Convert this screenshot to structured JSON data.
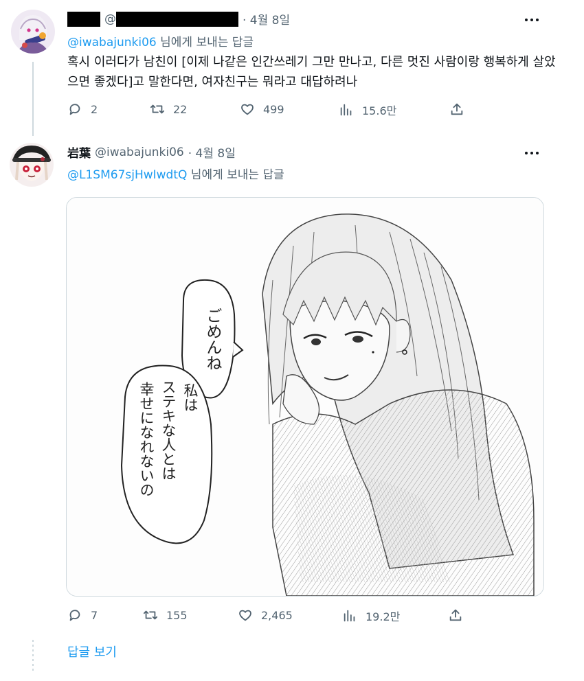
{
  "tweet1": {
    "handle_prefix": "@",
    "time": "· 4월 8일",
    "reply_handle": "@iwabajunki06",
    "reply_suffix": " 님에게 보내는 답글",
    "text": "혹시 이러다가 남친이 [이제 나같은 인간쓰레기 그만 만나고, 다른 멋진 사람이랑 행복하게 살았으면 좋겠다]고 말한다면, 여자친구는 뭐라고 대답하려나",
    "replies": "2",
    "retweets": "22",
    "likes": "499",
    "views": "15.6만"
  },
  "tweet2": {
    "name": "岩葉",
    "handle": "@iwabajunki06",
    "time": "· 4월 8일",
    "reply_handle": "@L1SM67sjHwIwdtQ",
    "reply_suffix": " 님에게 보내는 답글",
    "replies": "7",
    "retweets": "155",
    "likes": "2,465",
    "views": "19.2만",
    "image": {
      "bubble_small": "ごめんね",
      "bubble_large": [
        "私は",
        "ステキな人とは",
        "幸せになれないの"
      ]
    }
  },
  "show_replies": "답글 보기",
  "colors": {
    "accent": "#1d9bf0",
    "muted": "#536471",
    "text": "#0f1419",
    "border": "#cfd9de"
  },
  "icons": [
    "reply-icon",
    "retweet-icon",
    "like-icon",
    "views-icon",
    "share-icon",
    "more-icon"
  ]
}
